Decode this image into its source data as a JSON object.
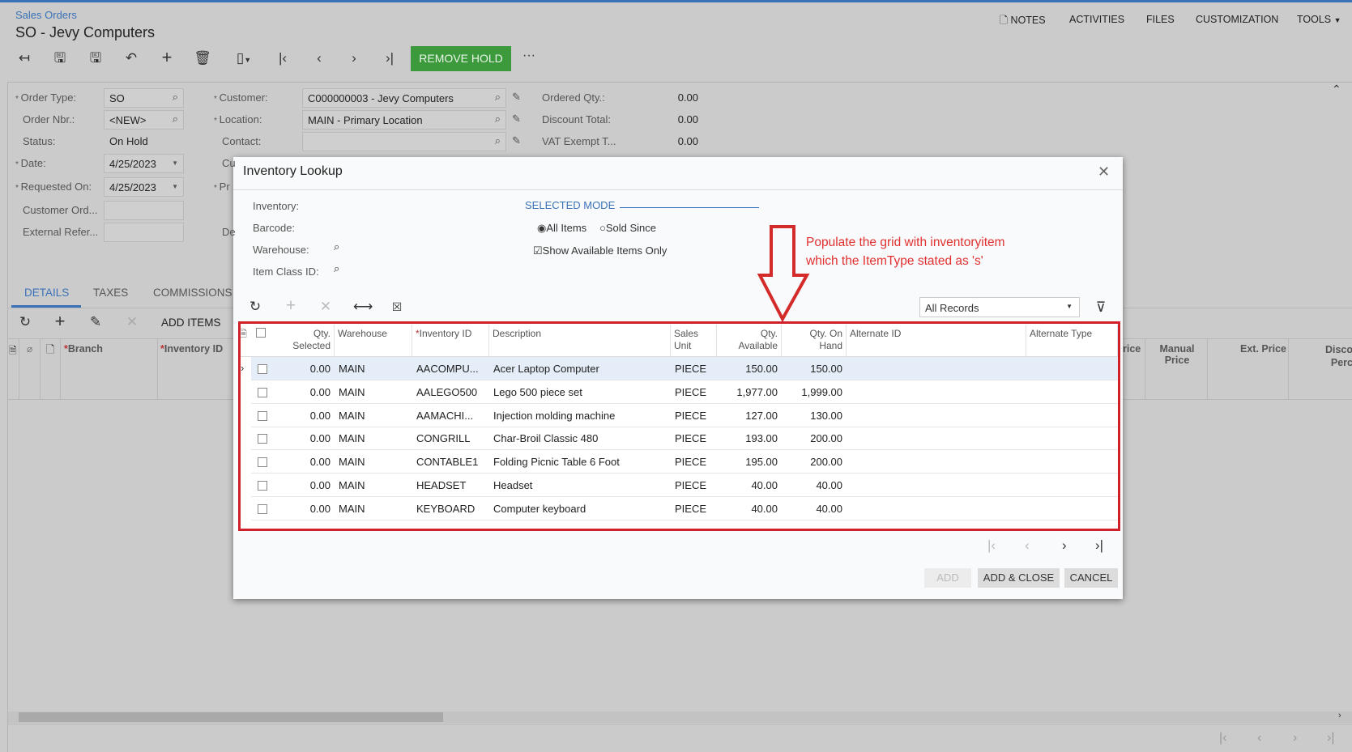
{
  "header": {
    "breadcrumb": "Sales Orders",
    "title": "SO - Jevy Computers",
    "links": [
      "NOTES",
      "ACTIVITIES",
      "FILES",
      "CUSTOMIZATION",
      "TOOLS"
    ]
  },
  "toolbar": {
    "remove_hold": "REMOVE HOLD",
    "more": "···",
    "accent": "#3c9a3c"
  },
  "form": {
    "left": [
      {
        "label": "Order Type:",
        "value": "SO",
        "req": true
      },
      {
        "label": "Order Nbr.:",
        "value": "<NEW>"
      },
      {
        "label": "Status:",
        "value": "On Hold"
      },
      {
        "label": "Date:",
        "value": "4/25/2023",
        "req": true
      },
      {
        "label": "Requested On:",
        "value": "4/25/2023",
        "req": true
      },
      {
        "label": "Customer Ord...",
        "value": ""
      },
      {
        "label": "External Refer...",
        "value": ""
      }
    ],
    "mid": [
      {
        "label": "Customer:",
        "value": "C000000003 - Jevy Computers",
        "req": true
      },
      {
        "label": "Location:",
        "value": "MAIN - Primary Location",
        "req": true
      },
      {
        "label": "Contact:",
        "value": ""
      }
    ],
    "mid_partial": [
      "Cu",
      "Pr",
      "De"
    ],
    "right": [
      {
        "label": "Ordered Qty.:",
        "value": "0.00"
      },
      {
        "label": "Discount Total:",
        "value": "0.00"
      },
      {
        "label": "VAT Exempt T...",
        "value": "0.00"
      }
    ]
  },
  "tabs": [
    "DETAILS",
    "TAXES",
    "COMMISSIONS"
  ],
  "details": {
    "add_items": "ADD ITEMS",
    "columns": [
      "Branch",
      "Inventory ID"
    ],
    "right_columns": [
      "rice",
      "Manual Price",
      "Ext. Price",
      "Disco Perc"
    ]
  },
  "dialog": {
    "title": "Inventory Lookup",
    "filters": [
      {
        "label": "Inventory:",
        "value": ""
      },
      {
        "label": "Barcode:",
        "value": ""
      },
      {
        "label": "Warehouse:",
        "value": ""
      },
      {
        "label": "Item Class ID:",
        "value": ""
      }
    ],
    "selected_mode": "SELECTED MODE",
    "radios": [
      {
        "label": "All Items",
        "checked": true
      },
      {
        "label": "Sold Since",
        "checked": false
      }
    ],
    "show_available": {
      "label": "Show Available Items Only",
      "checked": true
    },
    "records_filter": "All Records",
    "columns": [
      "Qty. Selected",
      "Warehouse",
      "Inventory ID",
      "Description",
      "Sales Unit",
      "Qty. Available",
      "Qty. On Hand",
      "Alternate ID",
      "Alternate Type"
    ],
    "rows": [
      [
        "0.00",
        "MAIN",
        "AACOMPU...",
        "Acer Laptop Computer",
        "PIECE",
        "150.00",
        "150.00",
        "",
        ""
      ],
      [
        "0.00",
        "MAIN",
        "AALEGO500",
        "Lego 500 piece set",
        "PIECE",
        "1,977.00",
        "1,999.00",
        "",
        ""
      ],
      [
        "0.00",
        "MAIN",
        "AAMACHI...",
        "Injection molding machine",
        "PIECE",
        "127.00",
        "130.00",
        "",
        ""
      ],
      [
        "0.00",
        "MAIN",
        "CONGRILL",
        "Char-Broil Classic 480",
        "PIECE",
        "193.00",
        "200.00",
        "",
        ""
      ],
      [
        "0.00",
        "MAIN",
        "CONTABLE1",
        "Folding Picnic Table 6 Foot",
        "PIECE",
        "195.00",
        "200.00",
        "",
        ""
      ],
      [
        "0.00",
        "MAIN",
        "HEADSET",
        "Headset",
        "PIECE",
        "40.00",
        "40.00",
        "",
        ""
      ],
      [
        "0.00",
        "MAIN",
        "KEYBOARD",
        "Computer keyboard",
        "PIECE",
        "40.00",
        "40.00",
        "",
        ""
      ]
    ],
    "buttons": {
      "add": "ADD",
      "add_close": "ADD & CLOSE",
      "cancel": "CANCEL"
    }
  },
  "annotation": {
    "line1": "Populate the grid with inventoryitem",
    "line2": "which the ItemType stated as 's'",
    "color": "#e03030"
  }
}
